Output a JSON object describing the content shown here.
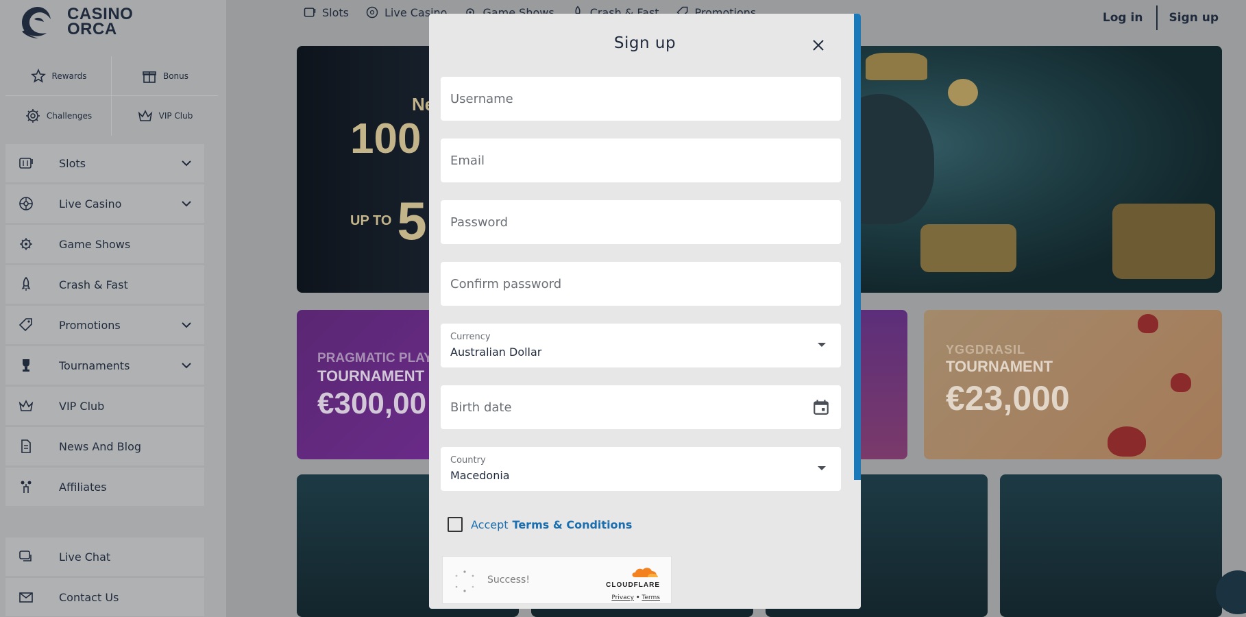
{
  "brand": {
    "name_line1": "CASINO",
    "name_line2": "ORCA"
  },
  "quick_links": [
    {
      "label": "Rewards",
      "icon": "star-badge-icon"
    },
    {
      "label": "Bonus",
      "icon": "gift-icon"
    },
    {
      "label": "Challenges",
      "icon": "gear-badge-icon"
    },
    {
      "label": "VIP Club",
      "icon": "crown-icon"
    }
  ],
  "sidebar": {
    "items": [
      {
        "label": "Slots",
        "icon": "slot-machine-icon",
        "expandable": true
      },
      {
        "label": "Live Casino",
        "icon": "roulette-icon",
        "expandable": true
      },
      {
        "label": "Game Shows",
        "icon": "wheel-icon",
        "expandable": false
      },
      {
        "label": "Crash & Fast",
        "icon": "rocket-icon",
        "expandable": false
      },
      {
        "label": "Promotions",
        "icon": "tag-icon",
        "expandable": true
      },
      {
        "label": "Tournaments",
        "icon": "trophy-icon",
        "expandable": true
      },
      {
        "label": "VIP Club",
        "icon": "crown-icon",
        "expandable": false
      },
      {
        "label": "News And Blog",
        "icon": "document-icon",
        "expandable": false
      },
      {
        "label": "Affiliates",
        "icon": "affiliate-icon",
        "expandable": false
      }
    ],
    "bottom_items": [
      {
        "label": "Live Chat",
        "icon": "chat-icon"
      },
      {
        "label": "Contact Us",
        "icon": "envelope-icon"
      }
    ]
  },
  "topnav": {
    "items": [
      {
        "label": "Slots",
        "icon": "slot-machine-icon"
      },
      {
        "label": "Live Casino",
        "icon": "roulette-icon"
      },
      {
        "label": "Game Shows",
        "icon": "wheel-icon"
      },
      {
        "label": "Crash & Fast",
        "icon": "rocket-icon"
      },
      {
        "label": "Promotions",
        "icon": "tag-icon"
      }
    ],
    "login": "Log in",
    "signup": "Sign up"
  },
  "banners": {
    "hero": {
      "line1": "Ne",
      "line2": "100",
      "line3_prefix": "UP TO",
      "line3_big": "5"
    },
    "pragmatic": {
      "line1": "PRAGMATIC PLAY",
      "line2": "TOURNAMENT",
      "line3": "€300,00"
    },
    "yggdrasil": {
      "line1": "YGGDRASIL",
      "line2": "TOURNAMENT",
      "line3": "€23,000"
    }
  },
  "modal": {
    "title": "Sign up",
    "username_placeholder": "Username",
    "email_placeholder": "Email",
    "password_placeholder": "Password",
    "confirm_password_placeholder": "Confirm password",
    "currency_label": "Currency",
    "currency_value": "Australian Dollar",
    "birthdate_placeholder": "Birth date",
    "country_label": "Country",
    "country_value": "Macedonia",
    "terms_accept": "Accept",
    "terms_link": "Terms & Conditions",
    "captcha": {
      "status": "Success!",
      "provider": "CLOUDFLARE",
      "privacy": "Privacy",
      "separator": "•",
      "terms": "Terms"
    }
  },
  "colors": {
    "accent": "#1a6fb0",
    "scrollbar": "#1a79b8",
    "text_dark": "#1f2a3c"
  }
}
